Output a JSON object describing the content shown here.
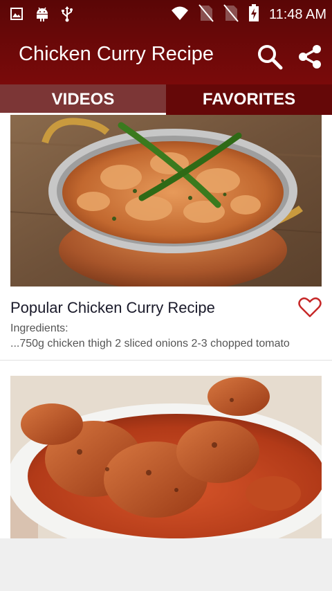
{
  "status_bar": {
    "time": "11:48 AM",
    "icons": [
      "image-icon",
      "android-icon",
      "usb-icon",
      "wifi-icon",
      "no-sim-icon",
      "no-sim-icon",
      "battery-charging-icon"
    ]
  },
  "app_bar": {
    "title": "Chicken Curry Recipe",
    "actions": [
      "search-icon",
      "share-icon"
    ]
  },
  "tabs": [
    {
      "label": "VIDEOS",
      "active": true
    },
    {
      "label": "FAVORITES",
      "active": false
    }
  ],
  "recipes": [
    {
      "title": "Popular Chicken Curry Recipe",
      "ingredients_label": "Ingredients:",
      "ingredients": "...750g chicken thigh  2 sliced onions  2-3 chopped tomato",
      "favorite": false
    },
    {
      "title": "",
      "ingredients_label": "",
      "ingredients": ""
    }
  ],
  "colors": {
    "primary_dark": "#5a0606",
    "primary": "#7a0a0a",
    "tab_active": "#7c3636",
    "heart": "#c62828"
  }
}
